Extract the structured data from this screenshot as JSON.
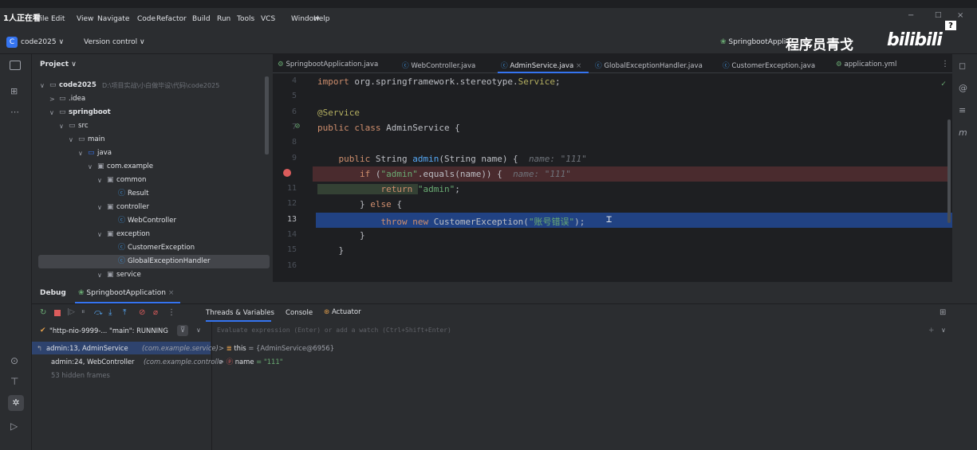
{
  "menubar": {
    "app_badge": "1人正在看",
    "items": [
      "File",
      "Edit",
      "View",
      "Navigate",
      "Code",
      "Refactor",
      "Build",
      "Run",
      "Tools",
      "VCS",
      "Window",
      "Help"
    ],
    "window_controls": [
      "−",
      "□",
      "×"
    ],
    "help_glyph": "?"
  },
  "titlebar": {
    "project_badge": "C",
    "project_name": "code2025",
    "version_control": "Version control",
    "run_config": "SpringbootAppli",
    "watermark_text": "程序员青戈",
    "watermark_logo": "bilibili"
  },
  "project_panel": {
    "header": "Project",
    "rows": [
      {
        "label": "code2025",
        "path": "D:\\项目实战\\小白做毕设\\代码\\code2025",
        "arrow": "∨",
        "icon": "▭",
        "bold": true
      },
      {
        "label": ".idea",
        "arrow": ">",
        "icon": "▭"
      },
      {
        "label": "springboot",
        "arrow": "∨",
        "icon": "▭",
        "bold": true
      },
      {
        "label": "src",
        "arrow": "∨",
        "icon": "▭"
      },
      {
        "label": "main",
        "arrow": "∨",
        "icon": "▭"
      },
      {
        "label": "java",
        "arrow": "∨",
        "icon": "▭"
      },
      {
        "label": "com.example",
        "arrow": "∨",
        "icon": "▣"
      },
      {
        "label": "common",
        "arrow": "∨",
        "icon": "▣"
      },
      {
        "label": "Result",
        "arrow": "",
        "icon": "ⓒ"
      },
      {
        "label": "controller",
        "arrow": "∨",
        "icon": "▣"
      },
      {
        "label": "WebController",
        "arrow": "",
        "icon": "ⓒ"
      },
      {
        "label": "exception",
        "arrow": "∨",
        "icon": "▣"
      },
      {
        "label": "CustomerException",
        "arrow": "",
        "icon": "ⓒ"
      },
      {
        "label": "GlobalExceptionHandler",
        "arrow": "",
        "icon": "ⓒ",
        "selected": true
      },
      {
        "label": "service",
        "arrow": "∨",
        "icon": "▣"
      }
    ]
  },
  "editor_tabs": [
    {
      "label": "SpringbootApplication.java",
      "icon": "⚙"
    },
    {
      "label": "WebController.java",
      "icon": "ⓒ"
    },
    {
      "label": "AdminService.java",
      "icon": "ⓒ",
      "active": true,
      "close": "×"
    },
    {
      "label": "GlobalExceptionHandler.java",
      "icon": "ⓒ"
    },
    {
      "label": "CustomerException.java",
      "icon": "ⓒ"
    },
    {
      "label": "application.yml",
      "icon": "⚙"
    }
  ],
  "editor": {
    "lines": [
      {
        "num": "4",
        "segments": [
          {
            "t": "import ",
            "c": "kw"
          },
          {
            "t": "org.springframework.stereotype.",
            "c": ""
          },
          {
            "t": "Service",
            "c": "ann"
          },
          {
            "t": ";",
            "c": ""
          }
        ]
      },
      {
        "num": "5",
        "segments": []
      },
      {
        "num": "6",
        "segments": [
          {
            "t": "@Service",
            "c": "ann"
          }
        ]
      },
      {
        "num": "7",
        "segments": [
          {
            "t": "public class ",
            "c": "kw"
          },
          {
            "t": "AdminService {",
            "c": ""
          }
        ]
      },
      {
        "num": "8",
        "segments": []
      },
      {
        "num": "9",
        "segments": [
          {
            "t": "    public ",
            "c": "kw"
          },
          {
            "t": "String ",
            "c": ""
          },
          {
            "t": "admin",
            "c": "fn"
          },
          {
            "t": "(String name) {  ",
            "c": ""
          },
          {
            "t": "name: \"111\"",
            "c": "hint"
          }
        ]
      },
      {
        "num": "10",
        "segments": [
          {
            "t": "        if ",
            "c": "kw"
          },
          {
            "t": "(",
            "c": ""
          },
          {
            "t": "\"admin\"",
            "c": "str"
          },
          {
            "t": ".equals(name)) {  ",
            "c": ""
          },
          {
            "t": "name: \"111\"",
            "c": "hint"
          }
        ],
        "breakpoint": true
      },
      {
        "num": "11",
        "segments": [
          {
            "t": "            return ",
            "c": "kw"
          },
          {
            "t": "\"admin\"",
            "c": "str"
          },
          {
            "t": ";",
            "c": ""
          }
        ]
      },
      {
        "num": "12",
        "segments": [
          {
            "t": "        } ",
            "c": ""
          },
          {
            "t": "else ",
            "c": "kw"
          },
          {
            "t": "{",
            "c": ""
          }
        ]
      },
      {
        "num": "13",
        "segments": [
          {
            "t": "            throw new ",
            "c": "kw"
          },
          {
            "t": "CustomerException(",
            "c": ""
          },
          {
            "t": "\"账号错误\"",
            "c": "str"
          },
          {
            "t": ");",
            "c": ""
          }
        ],
        "current": true
      },
      {
        "num": "14",
        "segments": [
          {
            "t": "        }",
            "c": ""
          }
        ]
      },
      {
        "num": "15",
        "segments": [
          {
            "t": "    }",
            "c": ""
          }
        ]
      },
      {
        "num": "16",
        "segments": []
      }
    ],
    "check_mark": "✓"
  },
  "debug": {
    "tab_debug": "Debug",
    "session": "SpringbootApplication",
    "session_close": "×",
    "subtabs": [
      "Threads & Variables",
      "Console",
      "Actuator"
    ],
    "thread": "\"http-nio-9999-... \"main\": RUNNING",
    "eval_placeholder": "Evaluate expression (Enter) or add a watch (Ctrl+Shift+Enter)",
    "frames": [
      {
        "label": "admin:13, AdminService",
        "pkg": "(com.example.service)",
        "selected": true
      },
      {
        "label": "admin:24, WebController",
        "pkg": "(com.example.controlle"
      },
      {
        "label": "53 hidden frames",
        "pkg": ""
      }
    ],
    "variables": [
      {
        "name": "this",
        "value": "= {AdminService@6956}",
        "icon": "≣"
      },
      {
        "name": "name",
        "value": "= \"111\"",
        "icon": "ⓟ"
      }
    ]
  }
}
